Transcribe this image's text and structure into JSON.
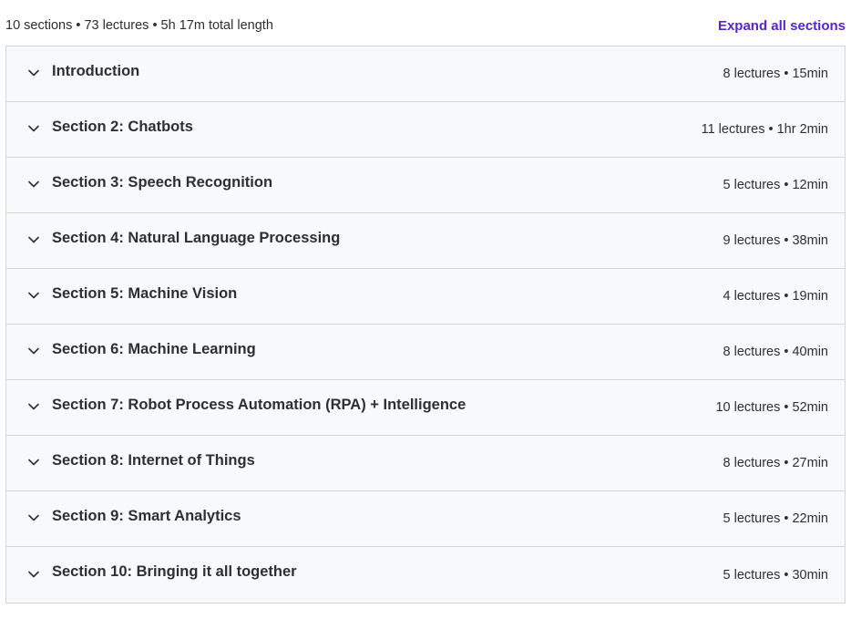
{
  "header": {
    "summary": "10 sections • 73 lectures • 5h 17m total length",
    "expand_all_label": "Expand all sections",
    "accent_color": "#5624d0"
  },
  "sections": [
    {
      "title": "Introduction",
      "meta": "8 lectures • 15min",
      "icon": "chevron-down-icon"
    },
    {
      "title": "Section 2: Chatbots",
      "meta": "11 lectures • 1hr 2min",
      "icon": "chevron-down-icon"
    },
    {
      "title": "Section 3: Speech Recognition",
      "meta": "5 lectures • 12min",
      "icon": "chevron-down-icon"
    },
    {
      "title": "Section 4: Natural Language Processing",
      "meta": "9 lectures • 38min",
      "icon": "chevron-down-icon"
    },
    {
      "title": "Section 5: Machine Vision",
      "meta": "4 lectures • 19min",
      "icon": "chevron-down-icon"
    },
    {
      "title": "Section 6: Machine Learning",
      "meta": "8 lectures • 40min",
      "icon": "chevron-down-icon"
    },
    {
      "title": "Section 7: Robot Process Automation (RPA) + Intelligence",
      "meta": "10 lectures • 52min",
      "icon": "chevron-down-icon"
    },
    {
      "title": "Section 8: Internet of Things",
      "meta": "8 lectures • 27min",
      "icon": "chevron-down-icon"
    },
    {
      "title": "Section 9: Smart Analytics",
      "meta": "5 lectures • 22min",
      "icon": "chevron-down-icon"
    },
    {
      "title": "Section 10: Bringing it all together",
      "meta": "5 lectures • 30min",
      "icon": "chevron-down-icon"
    }
  ]
}
